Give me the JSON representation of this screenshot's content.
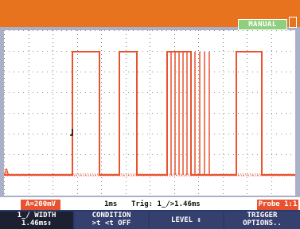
{
  "header": {
    "mode_label": "MANUAL"
  },
  "status": {
    "scale": "A=200mV",
    "timebase": "1ms",
    "trigger": "Trig: 1̲/>1.46ms",
    "probe": "Probe 1:1"
  },
  "softkeys": [
    {
      "line1": "1̲/ WIDTH",
      "line2": "1.46ms↕"
    },
    {
      "line1": "CONDITION",
      "line2": ">t <t OFF"
    },
    {
      "line1": "LEVEL ↕",
      "line2": ""
    },
    {
      "line1": "TRIGGER",
      "line2": "OPTIONS.."
    }
  ],
  "channel_marker": "A",
  "colors": {
    "trace": "#e8522f",
    "accent": "#e8731f",
    "softkey_bg": "#35406e",
    "mode_badge": "#8fd07f"
  }
}
